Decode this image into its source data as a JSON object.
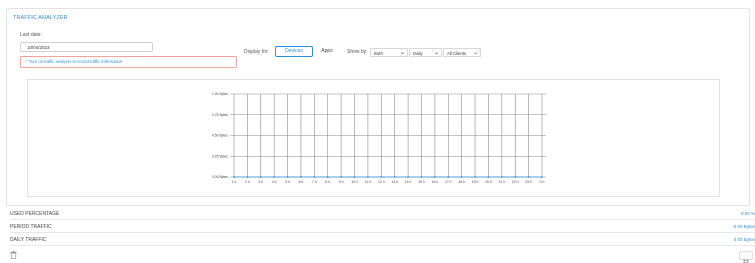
{
  "panel": {
    "title": "TRAFFIC ANALYZER",
    "last_date_label": "Last date:",
    "last_date_value": "10/04/2023",
    "alert_star": "*",
    "alert_text": " Turn on traffic analyzer to record traffic information"
  },
  "filters": {
    "display_for_label": "Display for:",
    "devices_label": "Devices",
    "apps_label": "Apps",
    "show_by_label": "Show by:",
    "direction_selected": "Both",
    "period_selected": "Daily",
    "clients_selected": "All Clients"
  },
  "chart_data": {
    "type": "line",
    "y_tick_labels": [
      "1.00 Bytes",
      "0.75 Bytes",
      "0.50 Bytes",
      "0.25 Bytes",
      "0.00 Bytes"
    ],
    "ylim": [
      0,
      1
    ],
    "categories": [
      "1 h",
      "2 h",
      "3 h",
      "4 h",
      "5 h",
      "6 h",
      "7 h",
      "8 h",
      "9 h",
      "10 h",
      "11 h",
      "12 h",
      "13 h",
      "14 h",
      "15 h",
      "16 h",
      "17 h",
      "18 h",
      "19 h",
      "20 h",
      "21 h",
      "22 h",
      "23 h",
      "0 h"
    ],
    "values": [
      0,
      0,
      0,
      0,
      0,
      0,
      0,
      0,
      0,
      0,
      0,
      0,
      0,
      0,
      0,
      0,
      0,
      0,
      0,
      0,
      0,
      0,
      0,
      0
    ],
    "grid": true,
    "series_color": "#2a8fd6"
  },
  "stats": {
    "used_percentage_label": "USED PERCENTAGE",
    "used_percentage_value": "0.00 %",
    "period_traffic_label": "PERIOD TRAFFIC",
    "period_traffic_value": "0.00 Bytes",
    "daily_traffic_label": "DAILY TRAFFIC",
    "daily_traffic_value": "0.00 Bytes"
  },
  "icons": {
    "delete": "trash-icon",
    "corner": "toggle-icon"
  }
}
